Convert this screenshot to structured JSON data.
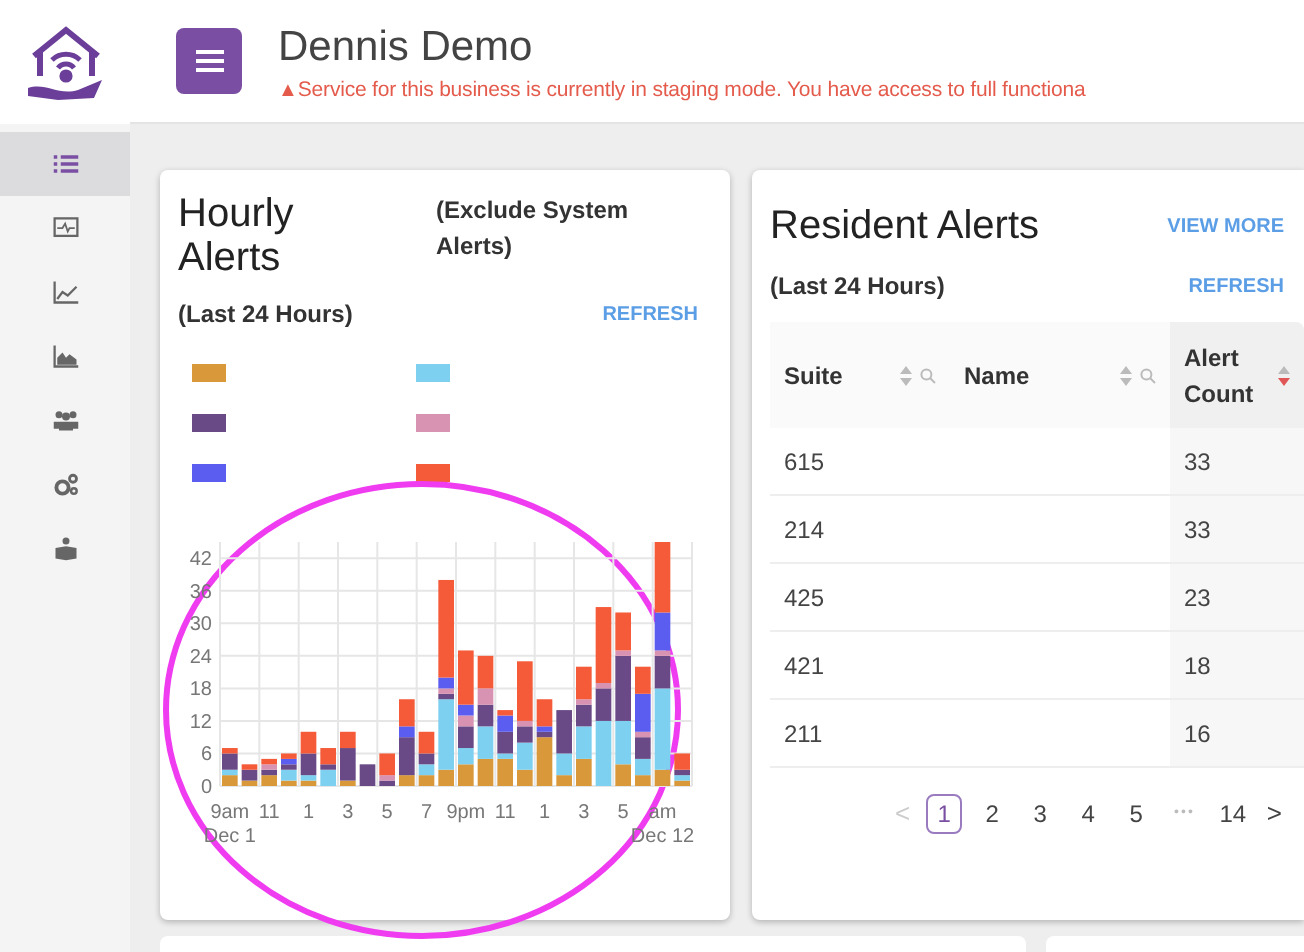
{
  "sidebar": {
    "items": [
      {
        "kind": "list",
        "selected": true
      },
      {
        "kind": "pulse",
        "selected": false
      },
      {
        "kind": "line",
        "selected": false
      },
      {
        "kind": "area",
        "selected": false
      },
      {
        "kind": "group",
        "selected": false
      },
      {
        "kind": "gears",
        "selected": false
      },
      {
        "kind": "parcel",
        "selected": false
      }
    ]
  },
  "header": {
    "title": "Dennis Demo",
    "warning_icon": "▲",
    "warning": "Service for this business is currently in staging mode. You have access to full functiona"
  },
  "hourly_alerts": {
    "title": "Hourly Alerts",
    "note": "(Exclude System Alerts)",
    "subtitle": "(Last 24 Hours)",
    "refresh": "REFRESH",
    "dates": [
      "Dec 1",
      "Dec 12"
    ],
    "chart_data": {
      "type": "bar",
      "stacked": true,
      "grid": true,
      "categories": [
        "9am",
        null,
        "11",
        null,
        "1",
        null,
        "3",
        null,
        "5",
        null,
        "7",
        null,
        "9pm",
        null,
        "11",
        null,
        "1",
        null,
        "3",
        null,
        "5",
        null,
        "am",
        null
      ],
      "ylim": [
        0,
        45
      ],
      "yticks": [
        0,
        6,
        12,
        18,
        24,
        30,
        36,
        42
      ],
      "series": [
        {
          "color": "#d9993a",
          "values": [
            2,
            1,
            2,
            1,
            1,
            0,
            1,
            0,
            0,
            2,
            2,
            3,
            4,
            5,
            5,
            3,
            9,
            2,
            5,
            0,
            4,
            2,
            3,
            1
          ]
        },
        {
          "color": "#7dd0ef",
          "values": [
            1,
            0,
            0,
            2,
            1,
            3,
            0,
            0,
            0,
            0,
            2,
            13,
            3,
            6,
            1,
            5,
            0,
            4,
            6,
            12,
            8,
            3,
            15,
            1
          ]
        },
        {
          "color": "#6a4a86",
          "values": [
            3,
            2,
            1,
            1,
            4,
            1,
            6,
            4,
            1,
            7,
            2,
            1,
            4,
            4,
            4,
            3,
            1,
            8,
            4,
            6,
            12,
            4,
            6,
            1
          ]
        },
        {
          "color": "#d993b2",
          "values": [
            0,
            0,
            1,
            0,
            0,
            0,
            0,
            0,
            1,
            0,
            0,
            1,
            2,
            3,
            0,
            1,
            0,
            0,
            1,
            1,
            1,
            1,
            1,
            0
          ]
        },
        {
          "color": "#5b5cf0",
          "values": [
            0,
            0,
            0,
            1,
            0,
            0,
            0,
            0,
            0,
            2,
            0,
            2,
            2,
            0,
            3,
            0,
            1,
            0,
            0,
            0,
            0,
            7,
            7,
            0
          ]
        },
        {
          "color": "#f55b38",
          "values": [
            1,
            1,
            1,
            1,
            4,
            3,
            3,
            0,
            4,
            5,
            4,
            18,
            10,
            6,
            1,
            11,
            5,
            0,
            6,
            14,
            7,
            5,
            13,
            3
          ]
        }
      ]
    }
  },
  "resident_alerts": {
    "title": "Resident Alerts",
    "view_more": "VIEW MORE",
    "subtitle": "(Last 24 Hours)",
    "refresh": "REFRESH",
    "columns": [
      {
        "label": "Suite",
        "sorted_descending": false,
        "searchable": true
      },
      {
        "label": "Name",
        "sorted_descending": false,
        "searchable": true
      },
      {
        "label": "Alert Count",
        "sorted_descending": true,
        "searchable": false
      }
    ],
    "rows": [
      [
        "615",
        "",
        "33"
      ],
      [
        "214",
        "",
        "33"
      ],
      [
        "425",
        "",
        "23"
      ],
      [
        "421",
        "",
        "18"
      ],
      [
        "211",
        "",
        "16"
      ]
    ],
    "pagination": {
      "prev": {
        "label": "<",
        "disabled": true
      },
      "items": [
        {
          "kind": "page",
          "label": "1",
          "selected": true
        },
        {
          "kind": "page",
          "label": "2",
          "selected": false
        },
        {
          "kind": "page",
          "label": "3",
          "selected": false
        },
        {
          "kind": "page",
          "label": "4",
          "selected": false
        },
        {
          "kind": "page",
          "label": "5",
          "selected": false
        },
        {
          "kind": "ellipsis",
          "label": "•••"
        },
        {
          "kind": "page",
          "label": "14",
          "selected": false
        }
      ],
      "next": {
        "label": ">",
        "disabled": false
      }
    }
  },
  "annotation": {
    "kind": "circle",
    "color": "#f03cf0"
  }
}
